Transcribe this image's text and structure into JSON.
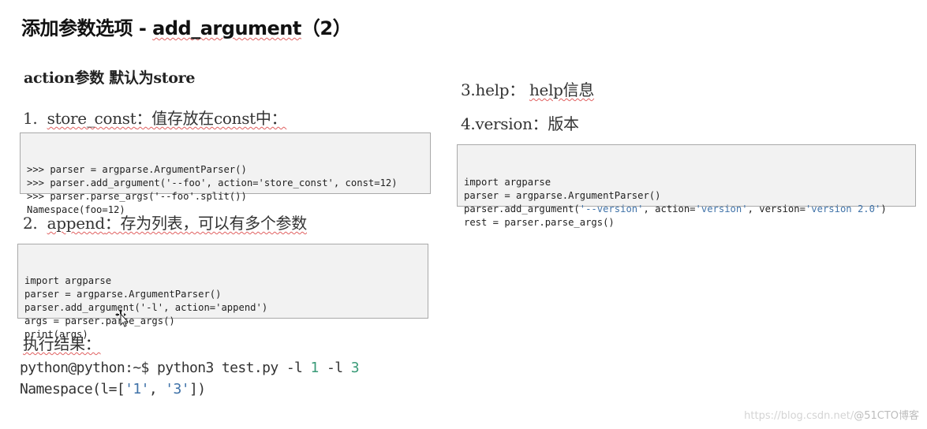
{
  "title": {
    "prefix": "添加参数选项 - ",
    "code": "add_argument",
    "suffix": "（2）"
  },
  "subtitle": "action参数 默认为store",
  "sections": {
    "store_const": {
      "number": "1.",
      "name": "store_const",
      "desc": "：值存放在const中：",
      "code": [
        ">>> parser = argparse.ArgumentParser()",
        ">>> parser.add_argument('--foo', action='store_const', const=12)",
        ">>> parser.parse_args('--foo'.split())",
        "Namespace(foo=12)"
      ]
    },
    "append": {
      "number": "2.",
      "name": "append",
      "desc": "：存为列表，可以有多个参数",
      "code": [
        "import argparse",
        "parser = argparse.ArgumentParser()",
        "parser.add_argument('-l', action='append')",
        "args = parser.parse_args()",
        "print(args)"
      ]
    },
    "result": {
      "label": "执行结果：",
      "prompt": "python@python:~$ python3 test.py -l ",
      "arg1": "1",
      "mid": " -l ",
      "arg2": "3",
      "out_prefix": "Namespace(l=[",
      "out_v1": "'1'",
      "out_sep": ", ",
      "out_v2": "'3'",
      "out_suffix": "])"
    },
    "help": {
      "label": "3.help：",
      "desc": "help信息"
    },
    "version": {
      "label": "4.version：版本",
      "code": {
        "line1": "import argparse",
        "line2": "parser = argparse.ArgumentParser()",
        "line3_a": "parser.add_argument(",
        "line3_s1": "'--version'",
        "line3_b": ", action=",
        "line3_s2": "'version'",
        "line3_c": ", version=",
        "line3_s3": "'version 2.0'",
        "line3_d": ")",
        "line4": "rest = parser.parse_args()"
      }
    }
  },
  "watermark": {
    "url": "https://blog.csdn.net/",
    "brand": "@51CTO博客"
  },
  "colors": {
    "string_blue": "#3f72a8",
    "number_green": "#3a9b78",
    "code_bg": "#f2f2f2",
    "code_border": "#a9a9a9"
  }
}
